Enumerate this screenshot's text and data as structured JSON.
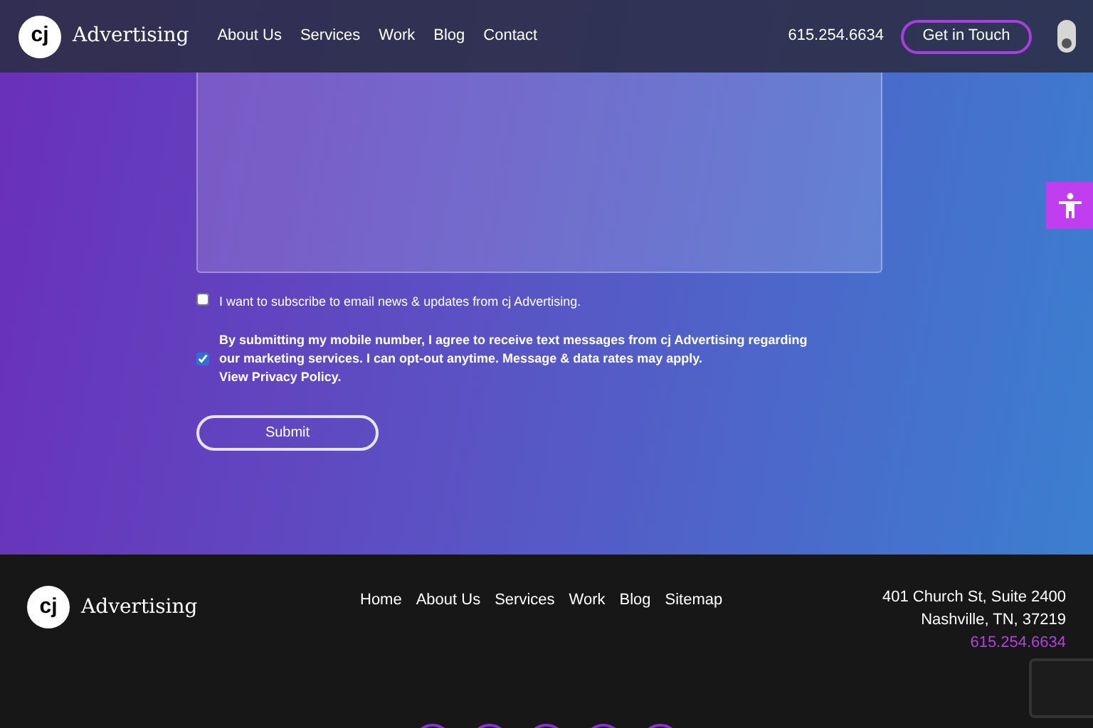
{
  "header": {
    "logo_mark": "cj",
    "logo_text": "Advertising",
    "nav": [
      "About Us",
      "Services",
      "Work",
      "Blog",
      "Contact"
    ],
    "phone": "615.254.6634",
    "cta": "Get in Touch"
  },
  "form": {
    "consents": [
      {
        "label": "I want to subscribe to email news & updates from cj Advertising.",
        "checked": false
      },
      {
        "label": "By submitting my mobile number, I agree to receive text messages from cj Advertising regarding our marketing services. I can opt-out anytime. Message & data rates may apply.",
        "link": "View Privacy Policy.",
        "checked": true
      }
    ],
    "submit": "Submit"
  },
  "footer": {
    "logo_mark": "cj",
    "logo_text": "Advertising",
    "nav": [
      "Home",
      "About Us",
      "Services",
      "Work",
      "Blog",
      "Sitemap"
    ],
    "address": [
      "401 Church St, Suite 2400",
      "Nashville, TN, 37219"
    ],
    "phone": "615.254.6634"
  }
}
